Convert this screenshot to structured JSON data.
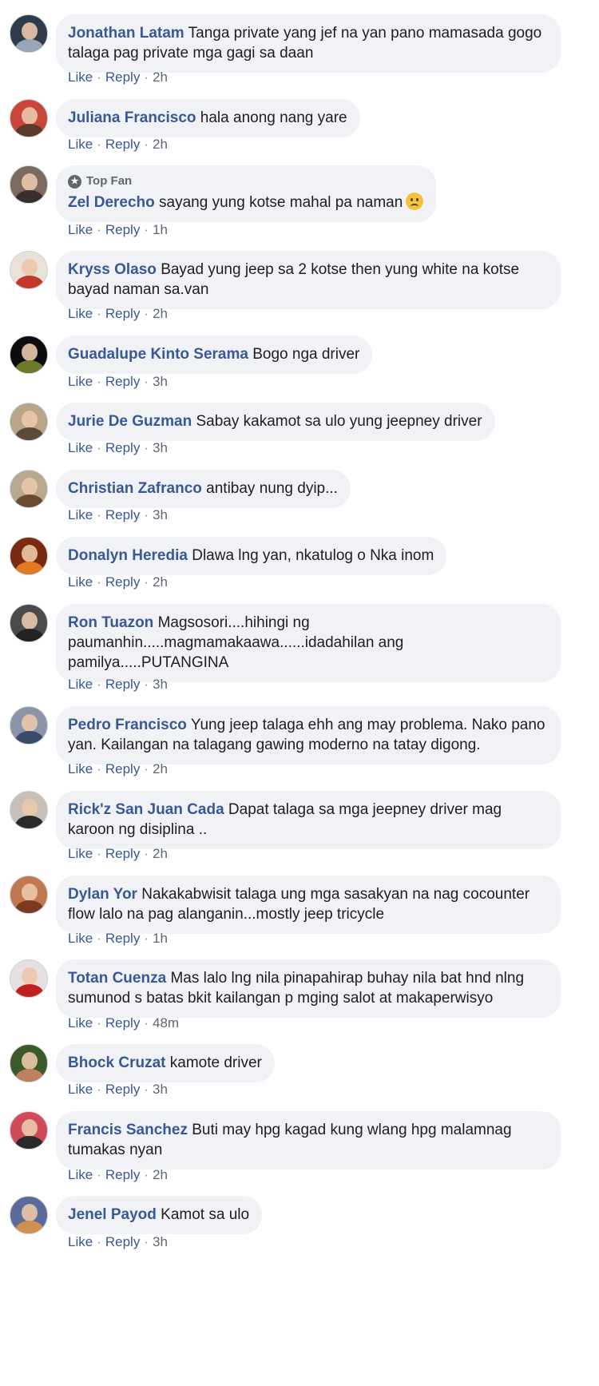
{
  "actions": {
    "like": "Like",
    "reply": "Reply",
    "sep": "·"
  },
  "top_fan_label": "Top Fan",
  "comments": [
    {
      "name": "Jonathan Latam",
      "text": "Tanga private yang jef na yan pano mamasada gogo talaga pag private mga gagi sa daan",
      "time": "2h",
      "avatar_bg": "#2f3a4a",
      "avatar_fg": "#9aa5b8"
    },
    {
      "name": "Juliana Francisco",
      "text": "hala anong nang yare",
      "time": "2h",
      "avatar_bg": "#c9463a",
      "avatar_fg": "#5a3a2a"
    },
    {
      "name": "Zel Derecho",
      "text": "sayang yung kotse mahal pa naman",
      "time": "1h",
      "top_fan": true,
      "emoji": "frowning-face",
      "avatar_bg": "#7a6a60",
      "avatar_fg": "#3a2e2a"
    },
    {
      "name": "Kryss Olaso",
      "text": "Bayad yung jeep sa 2 kotse then yung white na kotse bayad naman sa.van",
      "time": "2h",
      "avatar_bg": "#e8e2d8",
      "avatar_fg": "#c0392b"
    },
    {
      "name": "Guadalupe Kinto Serama",
      "text": "Bogo nga driver",
      "time": "3h",
      "avatar_bg": "#0c0c0c",
      "avatar_fg": "#6e7a2a"
    },
    {
      "name": "Jurie De Guzman",
      "text": "Sabay kakamot sa ulo yung jeepney driver",
      "time": "3h",
      "avatar_bg": "#b9a58a",
      "avatar_fg": "#5a4a3a"
    },
    {
      "name": "Christian Zafranco",
      "text": "antibay nung dyip...",
      "time": "3h",
      "avatar_bg": "#b8a890",
      "avatar_fg": "#6a4a30"
    },
    {
      "name": "Donalyn Heredia",
      "text": "Dlawa lng yan, nkatulog o Nka inom",
      "time": "2h",
      "avatar_bg": "#7a2a10",
      "avatar_fg": "#e07a20"
    },
    {
      "name": "Ron Tuazon",
      "text": "Magsosori....hihingi ng paumanhin.....magmamakaawa......idadahilan ang pamilya.....PUTANGINA",
      "time": "3h",
      "avatar_bg": "#4a4a4a",
      "avatar_fg": "#222222"
    },
    {
      "name": "Pedro Francisco",
      "text": "Yung jeep talaga ehh ang may problema. Nako pano yan. Kailangan na talagang gawing moderno na tatay digong.",
      "time": "2h",
      "avatar_bg": "#8a96a8",
      "avatar_fg": "#3a4a6a"
    },
    {
      "name": "Rick'z San Juan Cada",
      "text": "Dapat talaga sa mga jeepney driver mag karoon ng disiplina ..",
      "time": "2h",
      "avatar_bg": "#c8c0b8",
      "avatar_fg": "#2a2a2a"
    },
    {
      "name": "Dylan Yor",
      "text": "Nakakabwisit talaga ung mga sasakyan na nag cocounter flow lalo na pag alanganin...mostly jeep tricycle",
      "time": "1h",
      "avatar_bg": "#c07850",
      "avatar_fg": "#7a3a20"
    },
    {
      "name": "Totan Cuenza",
      "text": "Mas lalo lng nila pinapahirap buhay nila bat hnd nlng sumunod s batas bkit kailangan p mging salot at makaperwisyo",
      "time": "48m",
      "avatar_bg": "#e8e0e0",
      "avatar_fg": "#c02020"
    },
    {
      "name": "Bhock Cruzat",
      "text": "kamote driver",
      "time": "3h",
      "avatar_bg": "#3a5a2a",
      "avatar_fg": "#c08060"
    },
    {
      "name": "Francis Sanchez",
      "text": "Buti may hpg kagad kung wlang hpg malamnag tumakas nyan",
      "time": "2h",
      "avatar_bg": "#d04a5a",
      "avatar_fg": "#2a2a2a"
    },
    {
      "name": "Jenel Payod",
      "text": "Kamot sa ulo",
      "time": "3h",
      "avatar_bg": "#5a6a9a",
      "avatar_fg": "#d09050"
    }
  ]
}
